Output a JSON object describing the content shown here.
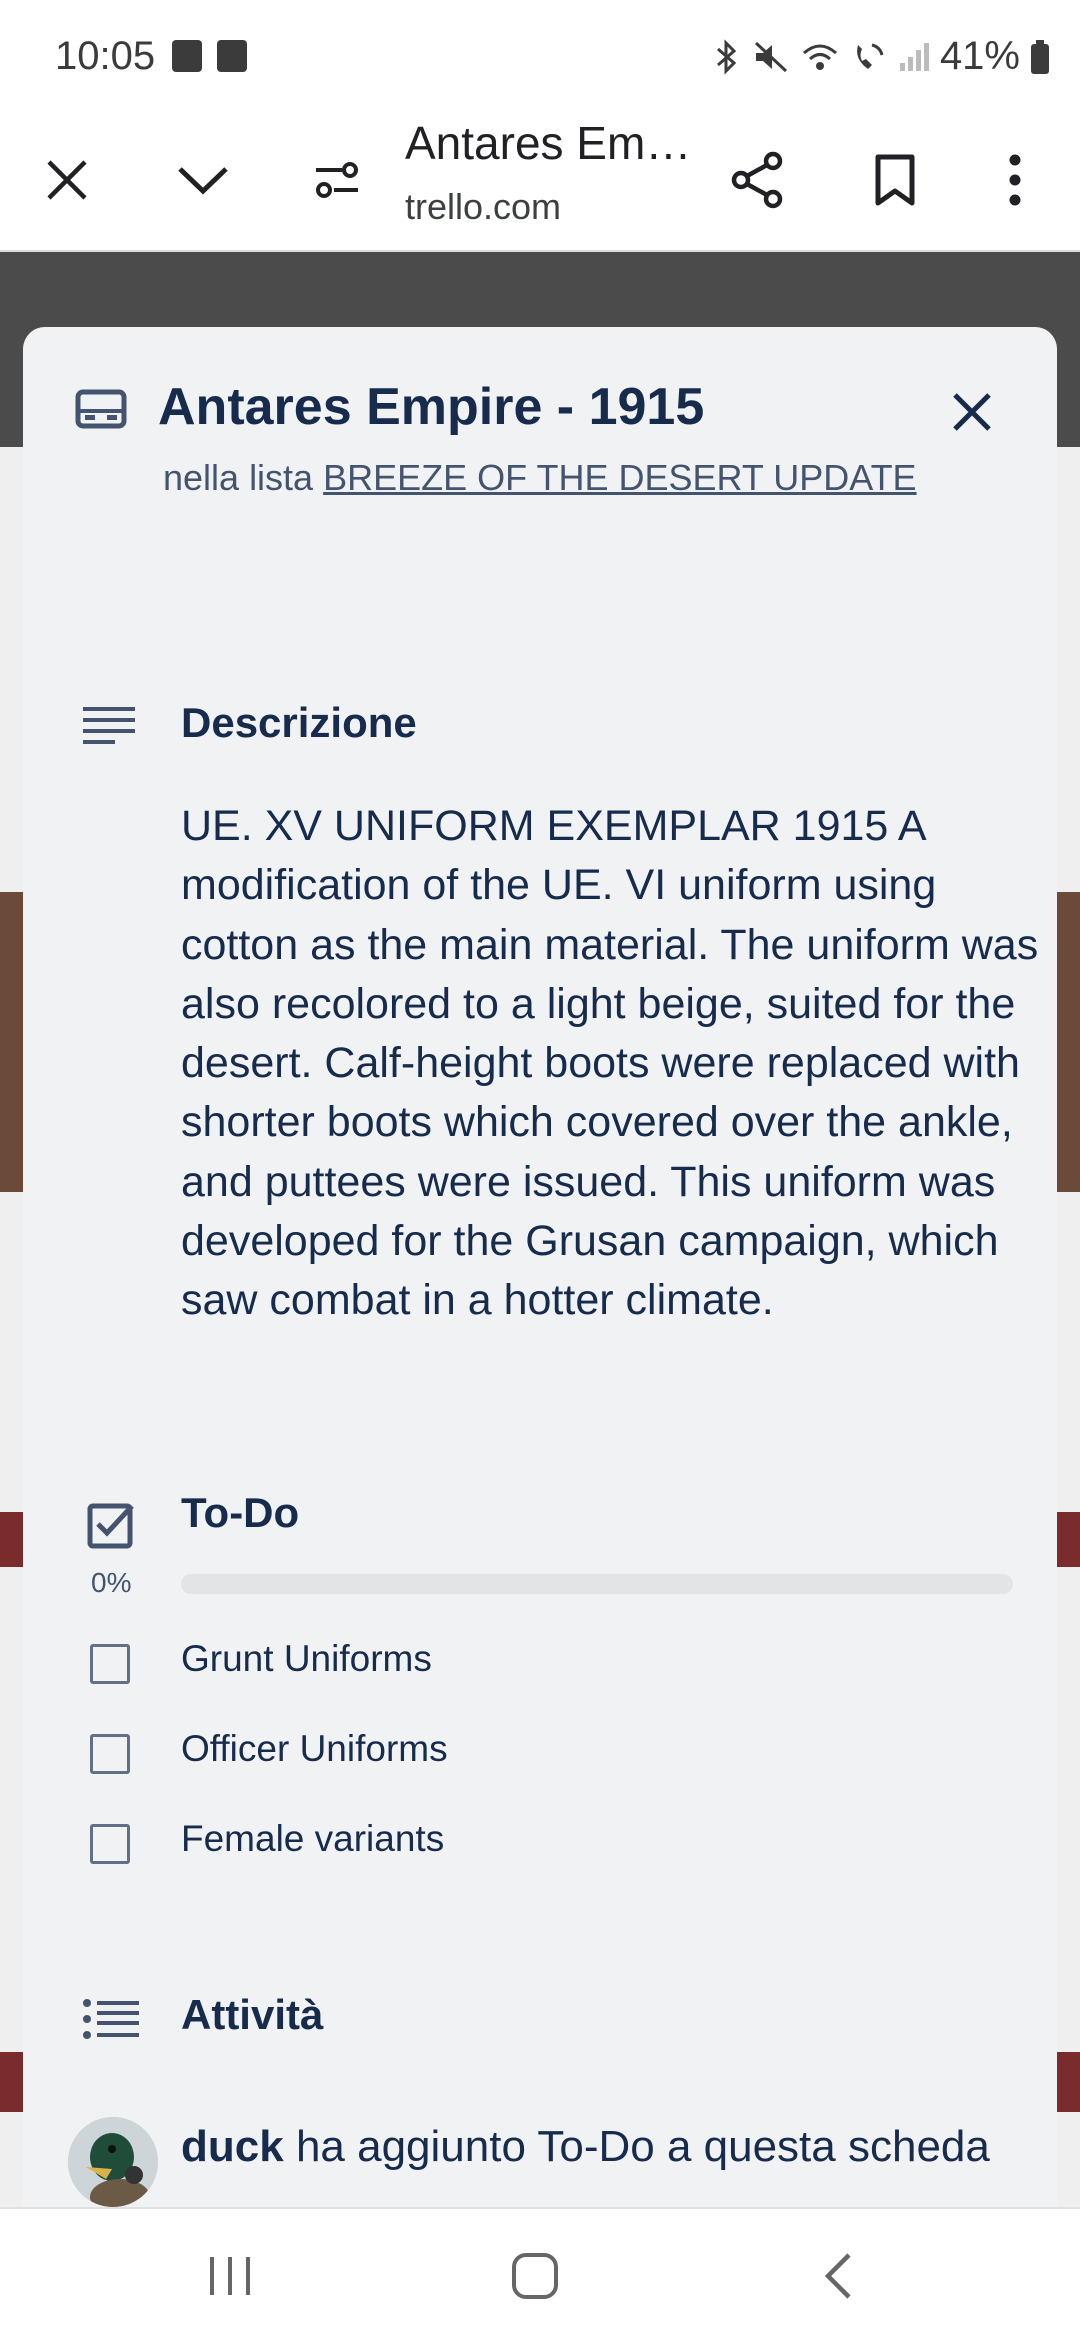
{
  "status_bar": {
    "time": "10:05",
    "icons": [
      "notification-icon",
      "gallery-icon",
      "bluetooth-icon",
      "mute-icon",
      "wifi-icon",
      "wifi-call-icon",
      "signal-icon"
    ],
    "battery_percent": "41%"
  },
  "browser": {
    "page_title": "Antares Empire - 1915",
    "url": "trello.com",
    "icons": [
      "close-icon",
      "chevron-down-icon",
      "tune-icon",
      "share-icon",
      "bookmark-icon",
      "more-vertical-icon"
    ]
  },
  "card": {
    "title": "Antares Empire - 1915",
    "list_prefix": "nella lista",
    "list_name": "BREEZE OF THE DESERT UPDATE",
    "description": {
      "heading": "Descrizione",
      "text": "UE. XV UNIFORM EXEMPLAR 1915 A modification of the UE. VI uniform using cotton as the main material. The uniform was also recolored to a light beige, suited for the desert. Calf-height boots were replaced with shorter boots which covered over the ankle, and puttees were issued. This uniform was developed for the Grusan campaign, which saw combat in a hotter climate."
    },
    "checklist": {
      "heading": "To-Do",
      "progress_label": "0%",
      "progress": 0,
      "items": [
        {
          "label": "Grunt Uniforms",
          "checked": false
        },
        {
          "label": "Officer Uniforms",
          "checked": false
        },
        {
          "label": "Female variants",
          "checked": false
        }
      ]
    },
    "activity": {
      "heading": "Attività",
      "entries": [
        {
          "user": "duck",
          "text": "ha aggiunto To-Do a questa scheda"
        }
      ]
    }
  },
  "colors": {
    "modal_bg": "#f1f2f4",
    "text_primary": "#172b4d",
    "text_secondary": "#44546f",
    "progress_track": "#e2e4e8"
  },
  "nav_bar": {
    "icons": [
      "recent-apps-icon",
      "home-icon",
      "back-icon"
    ]
  }
}
